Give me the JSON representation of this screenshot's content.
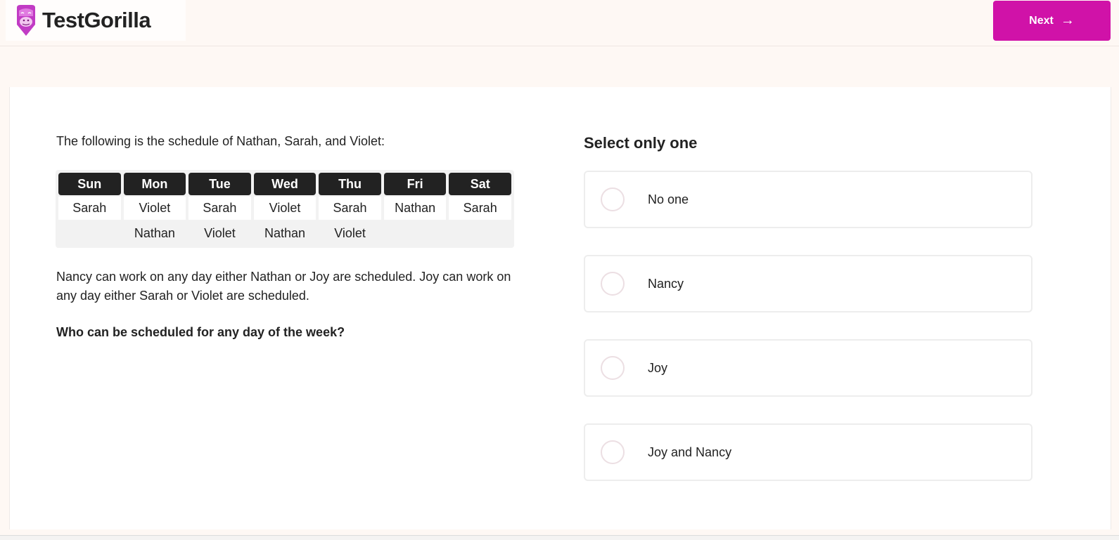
{
  "header": {
    "brand": "TestGorilla",
    "logo_icon": "gorilla-logo-icon",
    "brand_color": "#d012a8",
    "next_label": "Next",
    "next_icon": "arrow-right-icon"
  },
  "question": {
    "intro": "The following is the schedule of Nathan, Sarah, and Violet:",
    "schedule": {
      "days": [
        "Sun",
        "Mon",
        "Tue",
        "Wed",
        "Thu",
        "Fri",
        "Sat"
      ],
      "row1": [
        "Sarah",
        "Violet",
        "Sarah",
        "Violet",
        "Sarah",
        "Nathan",
        "Sarah"
      ],
      "row2": [
        "",
        "Nathan",
        "Violet",
        "Nathan",
        "Violet",
        "",
        ""
      ]
    },
    "paragraph": "Nancy can work on any day either Nathan or Joy are scheduled. Joy can work on any day either Sarah or Violet are scheduled.",
    "prompt": "Who can be scheduled for any day of the week?"
  },
  "answers": {
    "title": "Select only one",
    "options": [
      {
        "label": "No one",
        "selected": false
      },
      {
        "label": "Nancy",
        "selected": false
      },
      {
        "label": "Joy",
        "selected": false
      },
      {
        "label": "Joy and Nancy",
        "selected": false
      }
    ]
  }
}
